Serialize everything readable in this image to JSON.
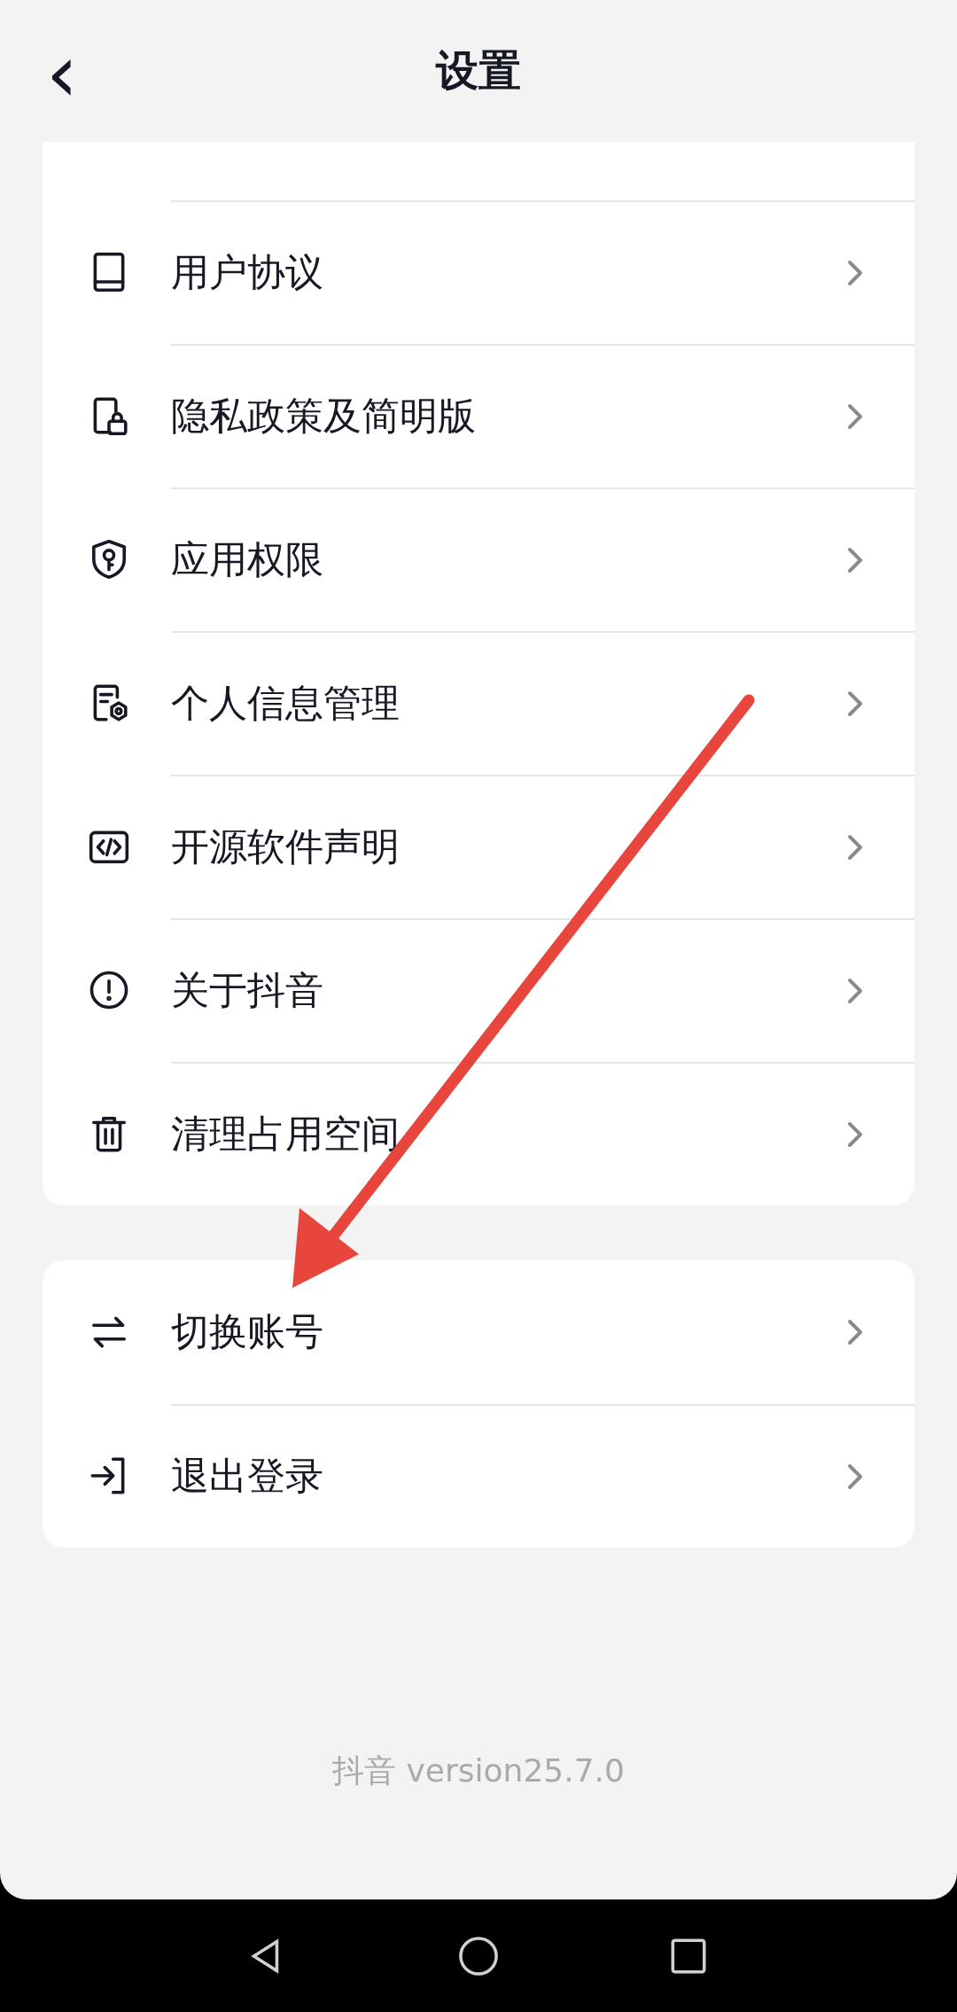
{
  "header": {
    "back": "‹",
    "title": "设置"
  },
  "groups": [
    {
      "items": [
        {
          "label": "用户协议"
        },
        {
          "label": "隐私政策及简明版"
        },
        {
          "label": "应用权限"
        },
        {
          "label": "个人信息管理"
        },
        {
          "label": "开源软件声明"
        },
        {
          "label": "关于抖音"
        },
        {
          "label": "清理占用空间"
        }
      ]
    },
    {
      "items": [
        {
          "label": "切换账号"
        },
        {
          "label": "退出登录"
        }
      ]
    }
  ],
  "footer": "抖音 version25.7.0",
  "annotation": {
    "kind": "arrow"
  }
}
